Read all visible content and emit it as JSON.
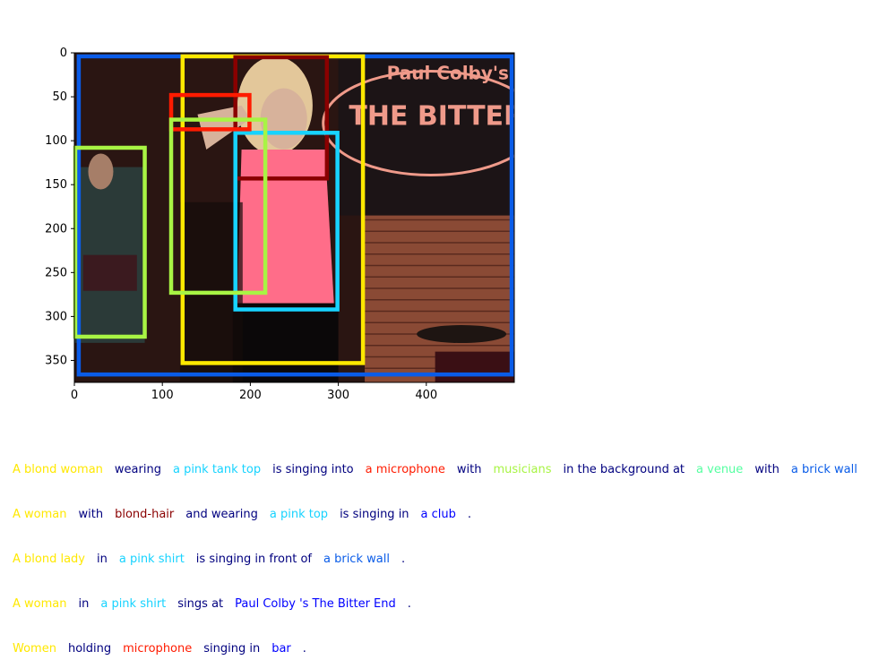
{
  "image": {
    "width": 500,
    "height": 375,
    "description_hidden": true,
    "scene_colors": {
      "background": "#2a1512",
      "banner": "#1c1416",
      "banner_text": "#ef9a8a",
      "brick": "#8a4a35",
      "skin": "#d7b29b",
      "hair": "#e3c79a",
      "pink_top": "#ff6d89",
      "dark": "#0b0809"
    },
    "banner_text_lines": [
      "Paul Colby's",
      "THE BITTER E"
    ]
  },
  "axes": {
    "xlim": [
      0,
      500
    ],
    "ylim": [
      375,
      0
    ],
    "xticks": [
      "0",
      "100",
      "200",
      "300",
      "400"
    ],
    "xtick_values": [
      0,
      100,
      200,
      300,
      400
    ],
    "yticks": [
      "0",
      "50",
      "100",
      "150",
      "200",
      "250",
      "300",
      "350"
    ],
    "ytick_values": [
      0,
      50,
      100,
      150,
      200,
      250,
      300,
      350
    ]
  },
  "boxes": [
    {
      "label": "venue",
      "color": "#0a5ce8",
      "x1": 5,
      "y1": 4,
      "x2": 497,
      "y2": 366
    },
    {
      "label": "woman",
      "color": "#ffe800",
      "x1": 123,
      "y1": 4,
      "x2": 328,
      "y2": 353
    },
    {
      "label": "blond-hair",
      "color": "#8a0000",
      "x1": 183,
      "y1": 5,
      "x2": 287,
      "y2": 143
    },
    {
      "label": "pink top",
      "color": "#17d3ff",
      "x1": 183,
      "y1": 91,
      "x2": 299,
      "y2": 292
    },
    {
      "label": "microphone",
      "color": "#ff1b00",
      "x1": 110,
      "y1": 48,
      "x2": 199,
      "y2": 87
    },
    {
      "label": "musicians",
      "color": "#a8f444",
      "x1": 110,
      "y1": 76,
      "x2": 217,
      "y2": 273
    },
    {
      "label": "musicians-2",
      "color": "#a8f444",
      "x1": 1,
      "y1": 108,
      "x2": 80,
      "y2": 323
    }
  ],
  "captions": [
    [
      {
        "text": "A blond woman",
        "color": "#ffe800"
      },
      {
        "text": "wearing",
        "color": "#00007f"
      },
      {
        "text": "a pink tank top",
        "color": "#17d3ff"
      },
      {
        "text": "is singing into",
        "color": "#00007f"
      },
      {
        "text": "a microphone",
        "color": "#ff1b00"
      },
      {
        "text": "with",
        "color": "#00007f"
      },
      {
        "text": "musicians",
        "color": "#a8f444"
      },
      {
        "text": "in the background at",
        "color": "#00007f"
      },
      {
        "text": "a venue",
        "color": "#55ffa1"
      },
      {
        "text": "with",
        "color": "#00007f"
      },
      {
        "text": "a brick wall",
        "color": "#0a5ce8"
      }
    ],
    [
      {
        "text": "A woman",
        "color": "#ffe800"
      },
      {
        "text": "with",
        "color": "#00007f"
      },
      {
        "text": "blond-hair",
        "color": "#8a0000"
      },
      {
        "text": "and wearing",
        "color": "#00007f"
      },
      {
        "text": "a pink top",
        "color": "#17d3ff"
      },
      {
        "text": "is singing in",
        "color": "#00007f"
      },
      {
        "text": "a club",
        "color": "#0000ff"
      },
      {
        "text": ".",
        "color": "#00007f"
      }
    ],
    [
      {
        "text": "A blond lady",
        "color": "#ffe800"
      },
      {
        "text": "in",
        "color": "#00007f"
      },
      {
        "text": "a pink shirt",
        "color": "#17d3ff"
      },
      {
        "text": "is singing in front of",
        "color": "#00007f"
      },
      {
        "text": "a brick wall",
        "color": "#0a5ce8"
      },
      {
        "text": ".",
        "color": "#00007f"
      }
    ],
    [
      {
        "text": "A woman",
        "color": "#ffe800"
      },
      {
        "text": "in",
        "color": "#00007f"
      },
      {
        "text": "a pink shirt",
        "color": "#17d3ff"
      },
      {
        "text": "sings at",
        "color": "#00007f"
      },
      {
        "text": "Paul Colby 's The Bitter End",
        "color": "#0000ff"
      },
      {
        "text": ".",
        "color": "#00007f"
      }
    ],
    [
      {
        "text": "Women",
        "color": "#ffe800"
      },
      {
        "text": "holding",
        "color": "#00007f"
      },
      {
        "text": "microphone",
        "color": "#ff1b00"
      },
      {
        "text": "singing in",
        "color": "#00007f"
      },
      {
        "text": "bar",
        "color": "#0000ff"
      },
      {
        "text": ".",
        "color": "#00007f"
      }
    ]
  ]
}
